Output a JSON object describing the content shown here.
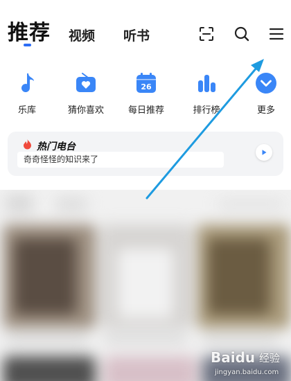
{
  "header": {
    "tabs": [
      {
        "label": "推荐",
        "active": true
      },
      {
        "label": "视频",
        "active": false
      },
      {
        "label": "听书",
        "active": false
      }
    ],
    "icons": [
      "scan-icon",
      "search-icon",
      "menu-icon"
    ]
  },
  "shortcuts": [
    {
      "label": "乐库",
      "icon": "music-note-icon"
    },
    {
      "label": "猜你喜欢",
      "icon": "radio-heart-icon"
    },
    {
      "label": "每日推荐",
      "icon": "calendar-icon",
      "badge": "26"
    },
    {
      "label": "排行榜",
      "icon": "bar-chart-icon"
    },
    {
      "label": "更多",
      "icon": "chevron-down-icon"
    }
  ],
  "hot_radio": {
    "title": "热门电台",
    "subtitle": "奇奇怪怪的知识来了"
  },
  "watermark": {
    "logo": "Baidu",
    "logo_suffix": "经验",
    "url": "jingyan.baidu.com"
  },
  "colors": {
    "accent": "#2b6cf5",
    "icon_blue": "#3a86f7",
    "annotation_arrow": "#1e9be0",
    "flame": "#f04a3c"
  }
}
